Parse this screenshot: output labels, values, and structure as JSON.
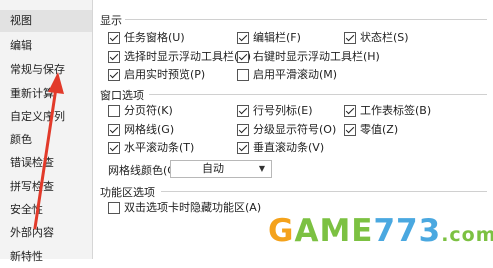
{
  "sidebar": {
    "items": [
      {
        "label": "视图",
        "active": true
      },
      {
        "label": "编辑",
        "active": false
      },
      {
        "label": "常规与保存",
        "active": false
      },
      {
        "label": "重新计算",
        "active": false
      },
      {
        "label": "自定义序列",
        "active": false
      },
      {
        "label": "颜色",
        "active": false
      },
      {
        "label": "错误检查",
        "active": false
      },
      {
        "label": "拼写检查",
        "active": false
      },
      {
        "label": "安全性",
        "active": false
      },
      {
        "label": "外部内容",
        "active": false
      },
      {
        "label": "新特性",
        "active": false
      }
    ]
  },
  "display": {
    "title": "显示",
    "options": [
      {
        "label": "任务窗格(U)",
        "checked": true
      },
      {
        "label": "编辑栏(F)",
        "checked": true
      },
      {
        "label": "状态栏(S)",
        "checked": true
      },
      {
        "label": "选择时显示浮动工具栏(D)",
        "checked": true
      },
      {
        "label": "右键时显示浮动工具栏(H)",
        "checked": true
      },
      {
        "label": "启用实时预览(P)",
        "checked": true
      },
      {
        "label": "启用平滑滚动(M)",
        "checked": false
      }
    ]
  },
  "window_options": {
    "title": "窗口选项",
    "options": [
      {
        "label": "分页符(K)",
        "checked": false
      },
      {
        "label": "行号列标(E)",
        "checked": true
      },
      {
        "label": "工作表标签(B)",
        "checked": true
      },
      {
        "label": "网格线(G)",
        "checked": true
      },
      {
        "label": "分级显示符号(O)",
        "checked": true
      },
      {
        "label": "零值(Z)",
        "checked": true
      },
      {
        "label": "水平滚动条(T)",
        "checked": true
      },
      {
        "label": "垂直滚动条(V)",
        "checked": true
      }
    ],
    "grid_color_label": "网格线颜色(C):",
    "grid_color_value": "自动"
  },
  "ribbon": {
    "title": "功能区选项",
    "options": [
      {
        "label": "双击选项卡时隐藏功能区(A)",
        "checked": false
      }
    ]
  },
  "watermark": {
    "part1": "G",
    "part2": "AME",
    "part3": "773",
    "part4": ".com"
  },
  "colors": {
    "annotation_arrow": "#e23a2a"
  },
  "icons": {
    "dropdown": "chevron-down-icon",
    "annotation": "red-arrow-annotation"
  }
}
